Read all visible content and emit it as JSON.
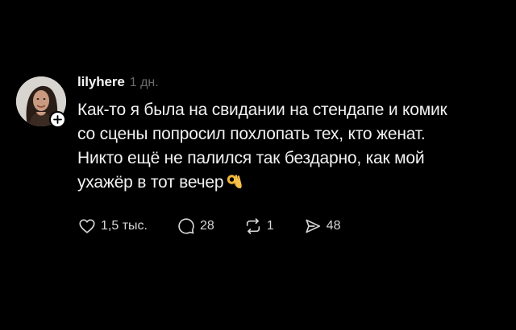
{
  "post": {
    "username": "lilyhere",
    "timestamp": "1 дн.",
    "text_lines": [
      "Как-то я была на свидании на стендапе и комик",
      "со сцены попросил похлопать тех, кто женат.",
      "Никто ещё не палился так бездарно, как мой",
      "ухажёр в тот вечер"
    ],
    "emoji": "ok-hand-emoji"
  },
  "actions": {
    "likes": "1,5 тыс.",
    "replies": "28",
    "reposts": "1",
    "shares": "48"
  },
  "icons": {
    "like": "heart-icon",
    "reply": "comment-bubble-icon",
    "repost": "repost-arrows-icon",
    "share": "send-icon",
    "follow": "plus-icon"
  },
  "colors": {
    "background": "#000000",
    "text": "#f1f1f1",
    "muted": "#6b6b6b",
    "icon": "#d6d6d6"
  }
}
